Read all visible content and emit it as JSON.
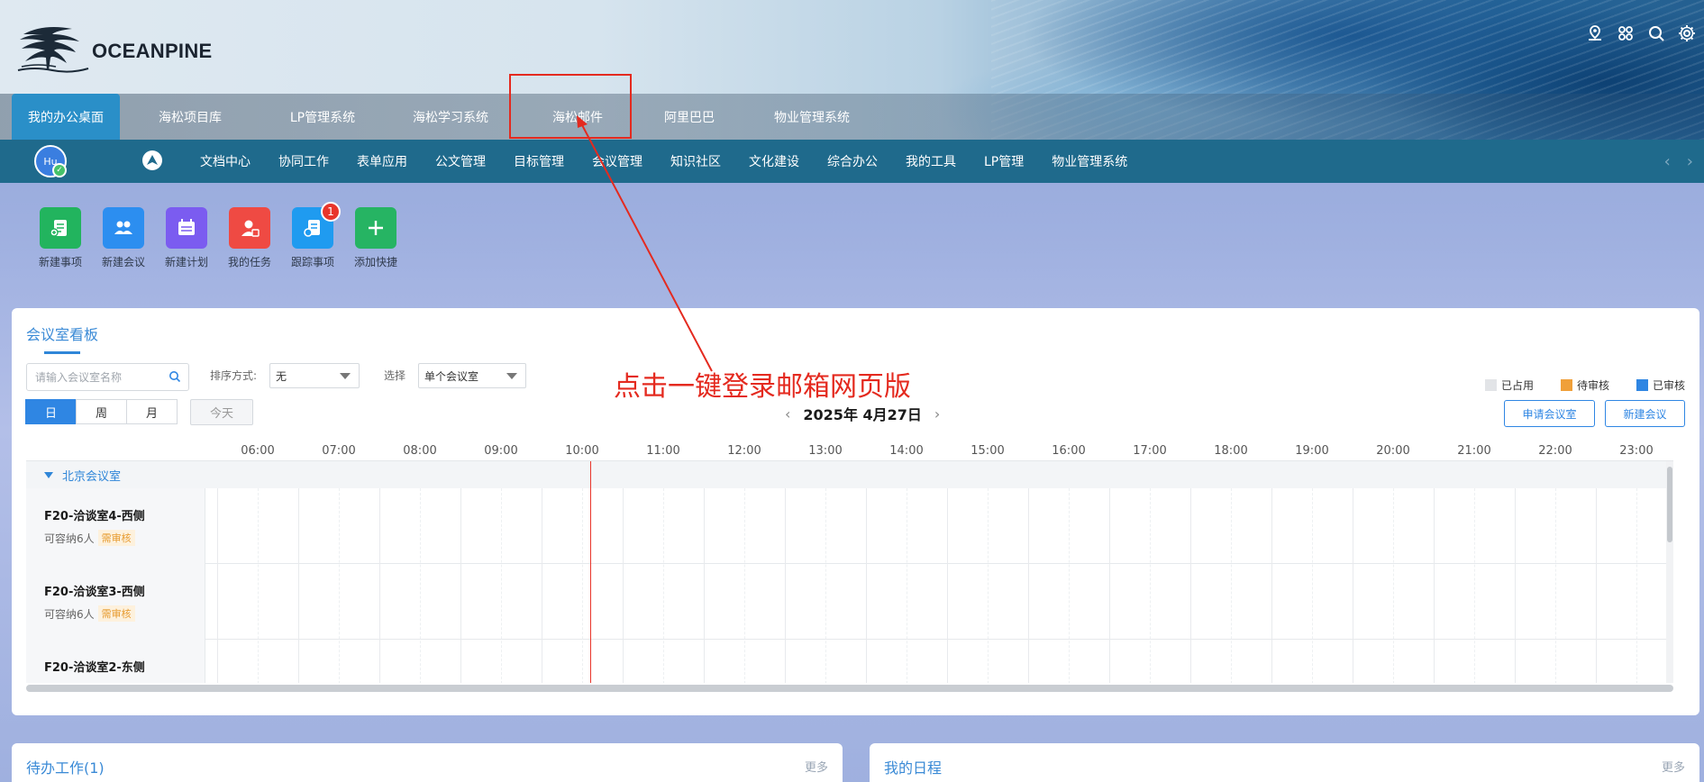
{
  "brand": {
    "name": "OCEANPINE"
  },
  "header_icons": [
    "map-pin-icon",
    "apps-icon",
    "search-icon",
    "settings-icon"
  ],
  "main_tabs": [
    {
      "label": "我的办公桌面",
      "active": true
    },
    {
      "label": "海松项目库"
    },
    {
      "label": "LP管理系统"
    },
    {
      "label": "海松学习系统"
    },
    {
      "label": "海松邮件"
    },
    {
      "label": "阿里巴巴"
    },
    {
      "label": "物业管理系统"
    }
  ],
  "user": {
    "avatar_text": "Hu"
  },
  "sub_nav": [
    "文档中心",
    "协同工作",
    "表单应用",
    "公文管理",
    "目标管理",
    "会议管理",
    "知识社区",
    "文化建设",
    "综合办公",
    "我的工具",
    "LP管理",
    "物业管理系统"
  ],
  "quick_actions": [
    {
      "label": "新建事项",
      "color": "#22b45e",
      "icon": "new-item-icon"
    },
    {
      "label": "新建会议",
      "color": "#2c8ef0",
      "icon": "new-meeting-icon"
    },
    {
      "label": "新建计划",
      "color": "#7b5cf0",
      "icon": "new-plan-icon"
    },
    {
      "label": "我的任务",
      "color": "#ef4a43",
      "icon": "my-task-icon"
    },
    {
      "label": "跟踪事项",
      "color": "#1f9bf0",
      "icon": "tracking-icon",
      "badge": "1"
    },
    {
      "label": "添加快捷",
      "color": "#26b463",
      "icon": "plus-icon"
    }
  ],
  "board": {
    "title": "会议室看板",
    "search_placeholder": "请输入会议室名称",
    "sort_label": "排序方式:",
    "sort_value": "无",
    "select_label": "选择",
    "select_value": "单个会议室",
    "views": [
      "日",
      "周",
      "月"
    ],
    "active_view": "日",
    "today_label": "今天",
    "date": "2025年 4月27日",
    "legend": [
      {
        "label": "已占用",
        "color": "#e2e4e7"
      },
      {
        "label": "待审核",
        "color": "#f0a03a"
      },
      {
        "label": "已审核",
        "color": "#2f86e3"
      }
    ],
    "apply_room_label": "申请会议室",
    "new_meeting_label": "新建会议",
    "hours": [
      "06:00",
      "07:00",
      "08:00",
      "09:00",
      "10:00",
      "11:00",
      "12:00",
      "13:00",
      "14:00",
      "15:00",
      "16:00",
      "17:00",
      "18:00",
      "19:00",
      "20:00",
      "21:00",
      "22:00",
      "23:00"
    ],
    "group": "北京会议室",
    "rooms": [
      {
        "name": "F20-洽谈室4-西侧",
        "capacity": "可容纳6人",
        "tag": "需审核"
      },
      {
        "name": "F20-洽谈室3-西侧",
        "capacity": "可容纳6人",
        "tag": "需审核"
      },
      {
        "name": "F20-洽谈室2-东侧",
        "capacity": "",
        "tag": ""
      }
    ]
  },
  "annotation": {
    "text": "点击一键登录邮箱网页版",
    "color": "#e42a1f"
  },
  "todo": {
    "title": "待办工作(1)",
    "more": "更多"
  },
  "schedule": {
    "title": "我的日程",
    "more": "更多"
  }
}
